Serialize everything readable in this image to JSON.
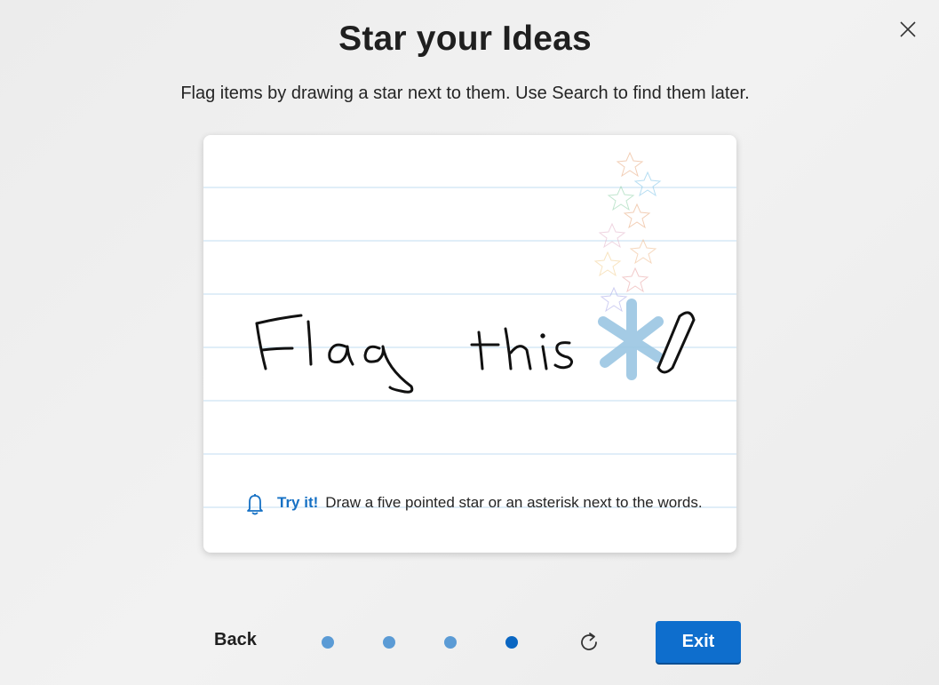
{
  "dialog": {
    "title": "Star your Ideas",
    "subtitle": "Flag items by drawing a star next to them. Use Search to find them later.",
    "close_icon": "close-icon"
  },
  "card": {
    "handwriting_text": "Flag this",
    "tip_label": "Try it!",
    "tip_text": "Draw a five pointed star or an asterisk next to the words.",
    "tip_icon": "bell-icon",
    "pen_icon": "pen-icon"
  },
  "footer": {
    "back_label": "Back",
    "exit_label": "Exit",
    "refresh_icon": "refresh-icon",
    "pager": {
      "total": 4,
      "current": 4
    }
  },
  "colors": {
    "accent": "#0e6ecd",
    "link": "#1570c4",
    "dot_inactive": "#5b9bd5",
    "dot_active": "#0a66c2",
    "ruled_line": "#cfe3f3"
  }
}
